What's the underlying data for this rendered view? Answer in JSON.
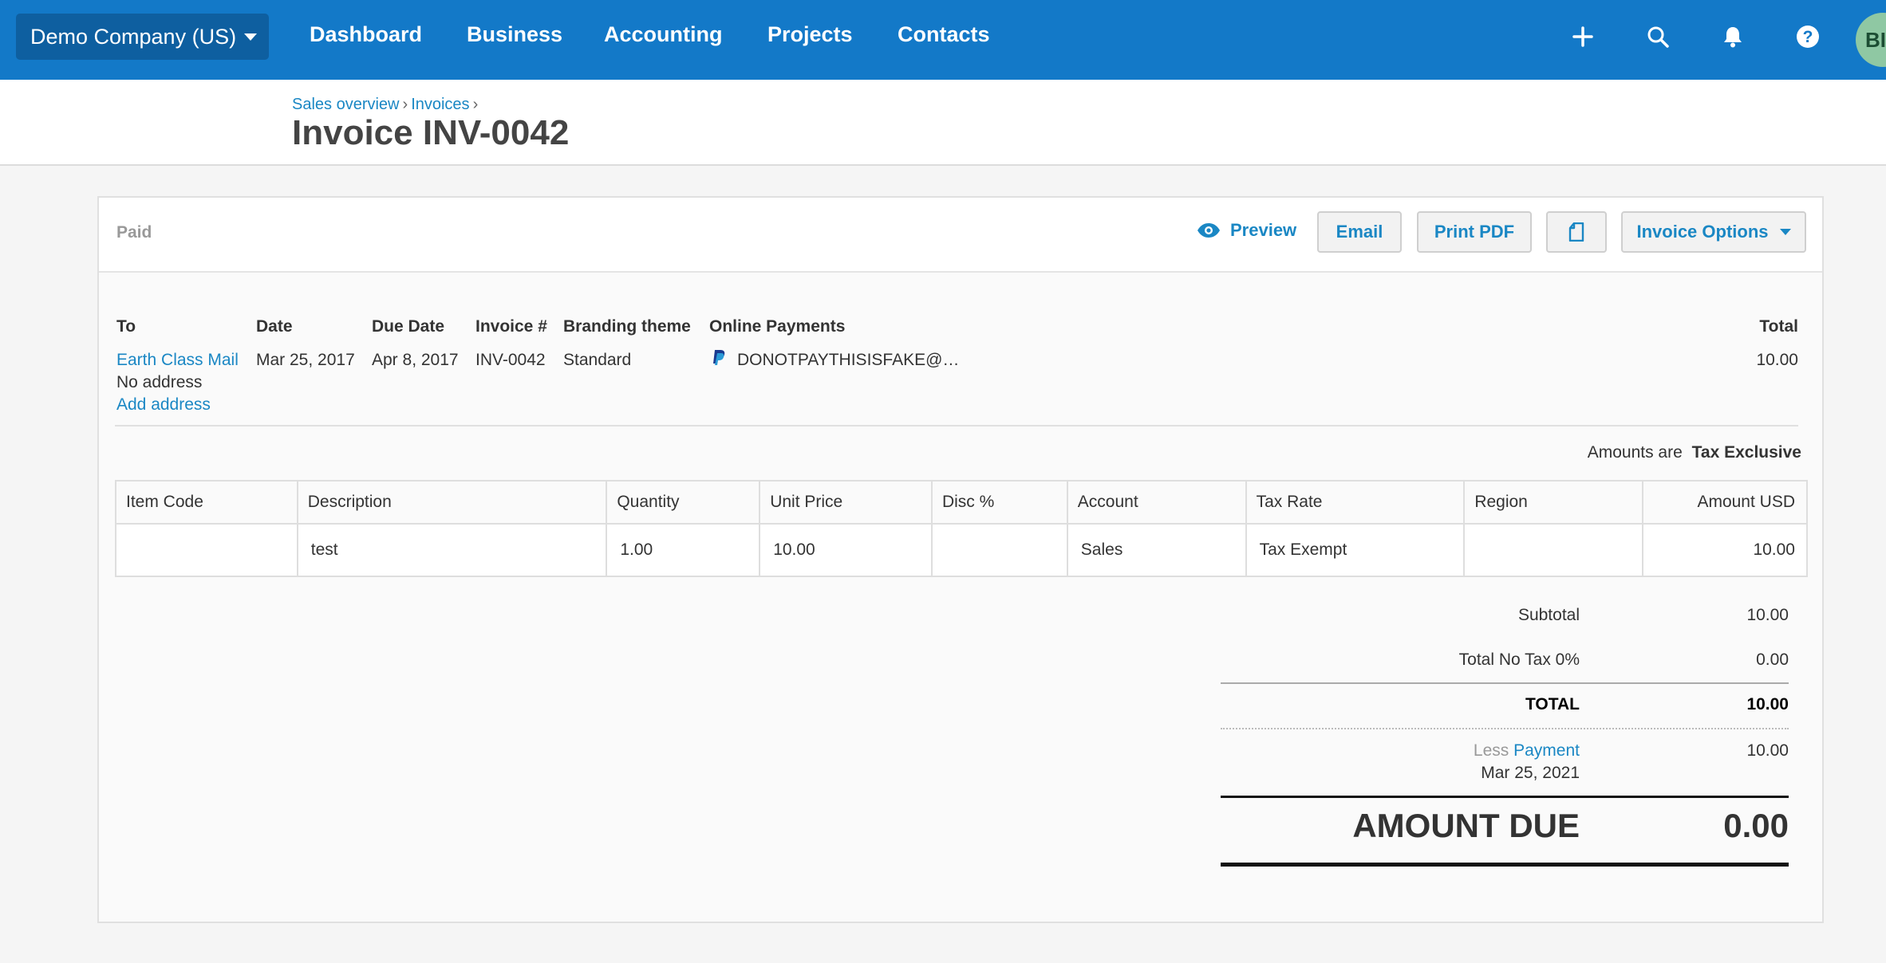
{
  "nav": {
    "org": "Demo Company (US)",
    "links": [
      "Dashboard",
      "Business",
      "Accounting",
      "Projects",
      "Contacts"
    ],
    "avatar": "BI",
    "icons": [
      "plus-icon",
      "search-icon",
      "bell-icon",
      "help-icon"
    ],
    "color": "#1379c8"
  },
  "breadcrumb": [
    "Sales overview",
    "Invoices"
  ],
  "title": "Invoice INV-0042",
  "toolbar": {
    "status": "Paid",
    "preview": "Preview",
    "email": "Email",
    "print_pdf": "Print PDF",
    "options": "Invoice Options"
  },
  "info": {
    "headers": {
      "to": "To",
      "date": "Date",
      "due_date": "Due Date",
      "invoice_no": "Invoice #",
      "branding": "Branding theme",
      "online": "Online Payments",
      "total": "Total"
    },
    "to_name": "Earth Class Mail",
    "to_address": "No address",
    "add_address": "Add address",
    "date": "Mar 25, 2017",
    "due_date": "Apr 8, 2017",
    "invoice_no": "INV-0042",
    "branding": "Standard",
    "online": "DONOTPAYTHISISFAKE@…",
    "total": "10.00"
  },
  "tax_note": {
    "prefix": "Amounts are",
    "value": "Tax Exclusive"
  },
  "table": {
    "headers": [
      "Item Code",
      "Description",
      "Quantity",
      "Unit Price",
      "Disc %",
      "Account",
      "Tax Rate",
      "Region",
      "Amount USD"
    ],
    "rows": [
      [
        "",
        "test",
        "1.00",
        "10.00",
        "",
        "Sales",
        "Tax Exempt",
        "",
        "10.00"
      ]
    ]
  },
  "totals": {
    "subtotal_label": "Subtotal",
    "subtotal": "10.00",
    "notax_label": "Total No Tax 0%",
    "notax": "0.00",
    "total_label": "TOTAL",
    "total": "10.00",
    "less": "Less",
    "payment": "Payment",
    "payment_date": "Mar 25, 2021",
    "payment_amount": "10.00",
    "due_label": "AMOUNT DUE",
    "due": "0.00"
  }
}
